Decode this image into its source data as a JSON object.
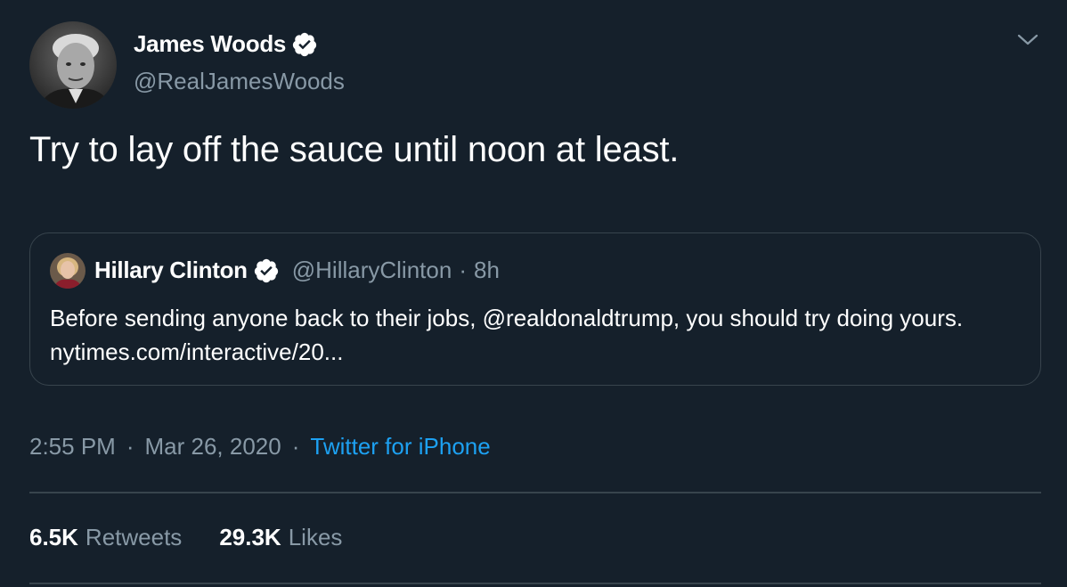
{
  "author": {
    "display_name": "James Woods",
    "handle": "@RealJamesWoods",
    "verified": true,
    "avatar_icon": "person-avatar-icon"
  },
  "tweet": {
    "text": "Try to lay off the sauce until noon at least."
  },
  "quoted_tweet": {
    "display_name": "Hillary Clinton",
    "handle": "@HillaryClinton",
    "separator": "·",
    "time": "8h",
    "text": "Before sending anyone back to their jobs, @realdonaldtrump, you should try doing yours. nytimes.com/interactive/20...",
    "verified": true
  },
  "meta": {
    "time": "2:55 PM",
    "separator": "·",
    "date": "Mar 26, 2020",
    "source": "Twitter for iPhone"
  },
  "stats": {
    "retweets_count": "6.5K",
    "retweets_label": "Retweets",
    "likes_count": "29.3K",
    "likes_label": "Likes"
  },
  "colors": {
    "background": "#15202b",
    "border": "#38444d",
    "secondary_text": "#8899a6",
    "accent": "#1da1f2",
    "verified_badge": "#ffffff"
  }
}
